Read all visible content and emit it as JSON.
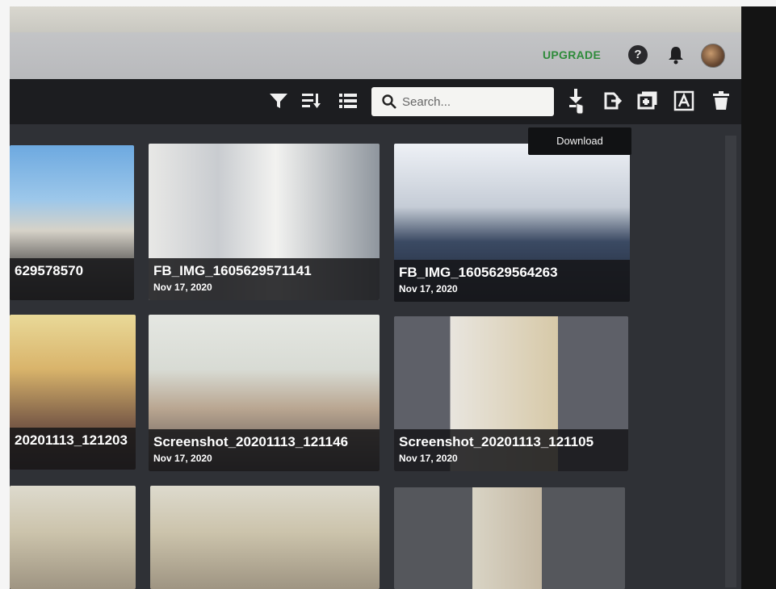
{
  "header": {
    "upgrade_label": "UPGRADE",
    "help_label": "?"
  },
  "toolbar": {
    "search_placeholder": "Search...",
    "tooltip": "Download"
  },
  "photos": [
    {
      "title": "629578570",
      "date": ""
    },
    {
      "title": "FB_IMG_1605629571141",
      "date": "Nov 17, 2020"
    },
    {
      "title": "FB_IMG_1605629564263",
      "date": "Nov 17, 2020"
    },
    {
      "title": "20201113_121203",
      "date": ""
    },
    {
      "title": "Screenshot_20201113_121146",
      "date": "Nov 17, 2020"
    },
    {
      "title": "Screenshot_20201113_121105",
      "date": "Nov 17, 2020"
    },
    {
      "title": "",
      "date": ""
    },
    {
      "title": "",
      "date": ""
    },
    {
      "title": "",
      "date": ""
    }
  ],
  "colors": {
    "upgrade": "#2e8b3a",
    "toolbar_bg": "#1c1d20",
    "gallery_bg": "#2f3136"
  }
}
